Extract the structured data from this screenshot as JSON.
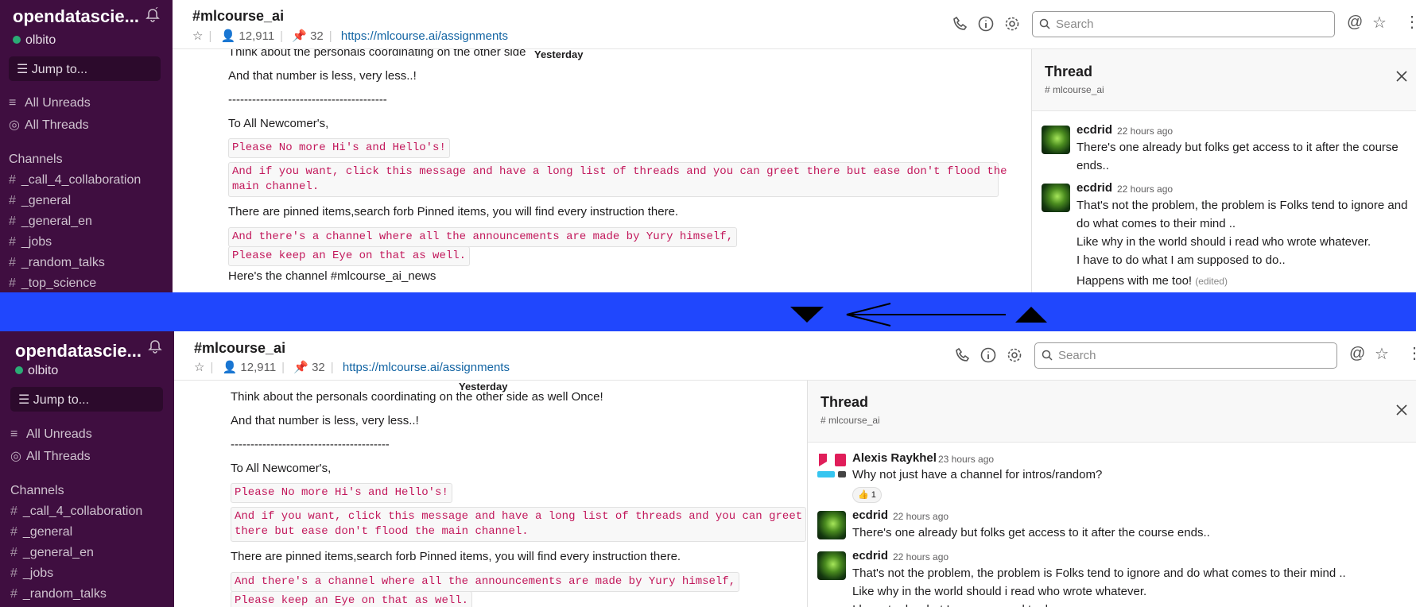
{
  "workspace": {
    "name": "opendatascie...",
    "user": "olbito"
  },
  "sidebar": {
    "jump": "Jump to...",
    "all_unreads": "All Unreads",
    "all_threads": "All Threads",
    "channels_heading": "Channels",
    "channels": [
      "_call_4_collaboration",
      "_general",
      "_general_en",
      "_jobs",
      "_random_talks",
      "_top_science"
    ],
    "hash": "#"
  },
  "header": {
    "channel": "#mlcourse_ai",
    "members": "12,911",
    "pins": "32",
    "link": "https://mlcourse.ai/assignments",
    "search_placeholder": "Search"
  },
  "messages": {
    "yesterday": "Yesterday",
    "line_top": "Think about the personals coordinating on the other side as well",
    "line_bottom": "Think about the personals coordinating on the other side as well Once!",
    "less": "And that number is less, very less..!",
    "dashes": "----------------------------------------",
    "newcomers": "To All Newcomer's,",
    "code1": "Please No more Hi's and Hello's!",
    "code2a_top": "And if you want, click this message and have a long list of threads and you can greet there but ease don't flood the",
    "code2b_top": "main channel.",
    "code2a_bottom": "And if you want, click this message and have a long list of threads and you can greet",
    "code2b_bottom": "there but ease don't flood the main channel.",
    "pinned": "There are pinned items,search forb Pinned items, you will find every instruction there.",
    "code3": "And there's a channel where all the announcements are made by Yury himself,",
    "code4": "Please keep an Eye on that as well.",
    "channel_news": "Here's the channel #mlcourse_ai_news"
  },
  "thread": {
    "title": "Thread",
    "channel": "# mlcourse_ai",
    "msg_alexis": {
      "name": "Alexis Raykhel",
      "time": "23 hours ago",
      "text": "Why not just have a channel for intros/random?",
      "reaction": "👍 1"
    },
    "msg1": {
      "name": "ecdrid",
      "time": "22 hours ago",
      "text": "There's one already but folks get access to it after the course ends.."
    },
    "msg2": {
      "name": "ecdrid",
      "time": "22 hours ago",
      "line1": "That's not the problem, the problem is Folks tend to ignore and do what comes to their mind ..",
      "line1a": "That's not the problem, the problem is Folks tend to ignore and",
      "line1b": "do what comes to their mind ..",
      "line2": "Like why in the world should i read who wrote whatever.",
      "line3": "I have to do what I am supposed to do.."
    },
    "msg3": {
      "text": "Happens with me too!",
      "edited": "(edited)"
    }
  },
  "colors": {
    "sidebar": "#3f0e40",
    "band": "#2047fd",
    "link": "#1264a3",
    "code": "#c2185b"
  },
  "icons": [
    "bell-icon",
    "phone-icon",
    "info-icon",
    "gear-icon",
    "search-icon",
    "mention-icon",
    "star-icon",
    "more-icon",
    "close-icon",
    "arrow-down-icon",
    "arrow-up-icon",
    "arrow-left-icon"
  ]
}
